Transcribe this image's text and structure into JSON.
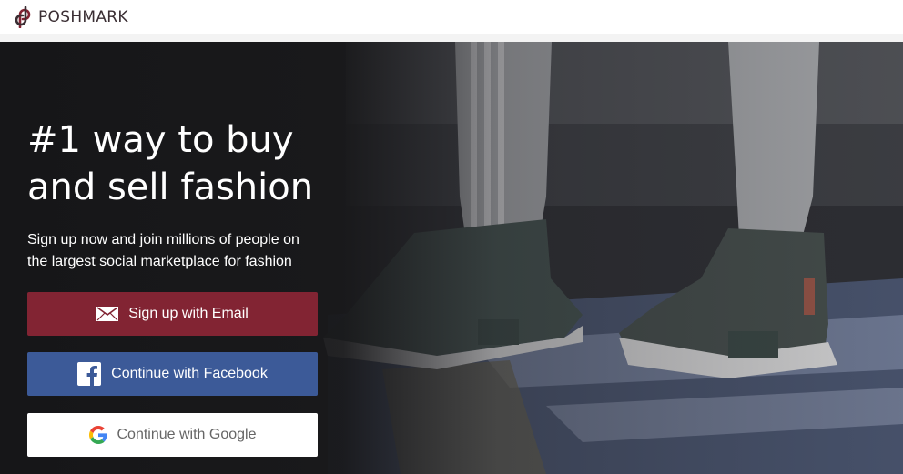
{
  "brand": {
    "name": "POSHMARK",
    "color": "#822433"
  },
  "hero": {
    "headline_line1": "#1 way to buy",
    "headline_line2": "and sell fashion",
    "subtext_line1": "Sign up now and join millions of people on",
    "subtext_line2": "the largest social marketplace for fashion"
  },
  "buttons": {
    "email": {
      "label": "Sign up with Email",
      "icon": "envelope-icon",
      "color": "#822433"
    },
    "facebook": {
      "label": "Continue with Facebook",
      "icon": "facebook-icon",
      "color": "#3c5a98"
    },
    "google": {
      "label": "Continue with Google",
      "icon": "google-icon",
      "color": "#ffffff"
    }
  }
}
